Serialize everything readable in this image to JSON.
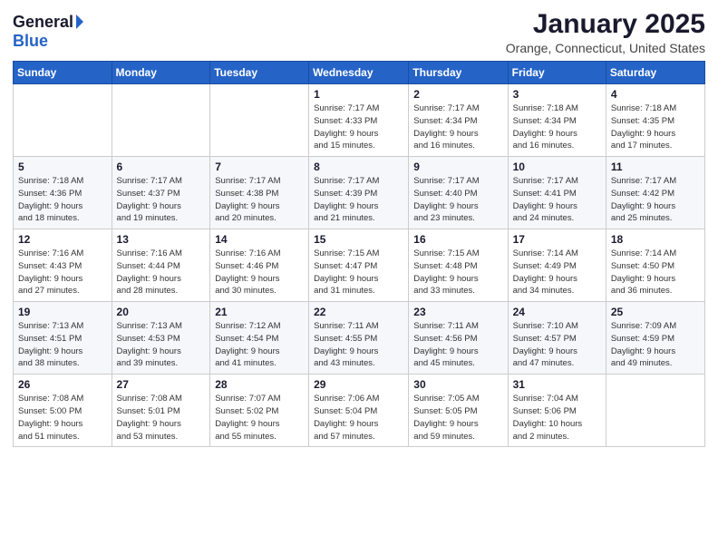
{
  "logo": {
    "general": "General",
    "blue": "Blue"
  },
  "title": "January 2025",
  "location": "Orange, Connecticut, United States",
  "weekdays": [
    "Sunday",
    "Monday",
    "Tuesday",
    "Wednesday",
    "Thursday",
    "Friday",
    "Saturday"
  ],
  "weeks": [
    [
      {
        "day": "",
        "info": ""
      },
      {
        "day": "",
        "info": ""
      },
      {
        "day": "",
        "info": ""
      },
      {
        "day": "1",
        "info": "Sunrise: 7:17 AM\nSunset: 4:33 PM\nDaylight: 9 hours\nand 15 minutes."
      },
      {
        "day": "2",
        "info": "Sunrise: 7:17 AM\nSunset: 4:34 PM\nDaylight: 9 hours\nand 16 minutes."
      },
      {
        "day": "3",
        "info": "Sunrise: 7:18 AM\nSunset: 4:34 PM\nDaylight: 9 hours\nand 16 minutes."
      },
      {
        "day": "4",
        "info": "Sunrise: 7:18 AM\nSunset: 4:35 PM\nDaylight: 9 hours\nand 17 minutes."
      }
    ],
    [
      {
        "day": "5",
        "info": "Sunrise: 7:18 AM\nSunset: 4:36 PM\nDaylight: 9 hours\nand 18 minutes."
      },
      {
        "day": "6",
        "info": "Sunrise: 7:17 AM\nSunset: 4:37 PM\nDaylight: 9 hours\nand 19 minutes."
      },
      {
        "day": "7",
        "info": "Sunrise: 7:17 AM\nSunset: 4:38 PM\nDaylight: 9 hours\nand 20 minutes."
      },
      {
        "day": "8",
        "info": "Sunrise: 7:17 AM\nSunset: 4:39 PM\nDaylight: 9 hours\nand 21 minutes."
      },
      {
        "day": "9",
        "info": "Sunrise: 7:17 AM\nSunset: 4:40 PM\nDaylight: 9 hours\nand 23 minutes."
      },
      {
        "day": "10",
        "info": "Sunrise: 7:17 AM\nSunset: 4:41 PM\nDaylight: 9 hours\nand 24 minutes."
      },
      {
        "day": "11",
        "info": "Sunrise: 7:17 AM\nSunset: 4:42 PM\nDaylight: 9 hours\nand 25 minutes."
      }
    ],
    [
      {
        "day": "12",
        "info": "Sunrise: 7:16 AM\nSunset: 4:43 PM\nDaylight: 9 hours\nand 27 minutes."
      },
      {
        "day": "13",
        "info": "Sunrise: 7:16 AM\nSunset: 4:44 PM\nDaylight: 9 hours\nand 28 minutes."
      },
      {
        "day": "14",
        "info": "Sunrise: 7:16 AM\nSunset: 4:46 PM\nDaylight: 9 hours\nand 30 minutes."
      },
      {
        "day": "15",
        "info": "Sunrise: 7:15 AM\nSunset: 4:47 PM\nDaylight: 9 hours\nand 31 minutes."
      },
      {
        "day": "16",
        "info": "Sunrise: 7:15 AM\nSunset: 4:48 PM\nDaylight: 9 hours\nand 33 minutes."
      },
      {
        "day": "17",
        "info": "Sunrise: 7:14 AM\nSunset: 4:49 PM\nDaylight: 9 hours\nand 34 minutes."
      },
      {
        "day": "18",
        "info": "Sunrise: 7:14 AM\nSunset: 4:50 PM\nDaylight: 9 hours\nand 36 minutes."
      }
    ],
    [
      {
        "day": "19",
        "info": "Sunrise: 7:13 AM\nSunset: 4:51 PM\nDaylight: 9 hours\nand 38 minutes."
      },
      {
        "day": "20",
        "info": "Sunrise: 7:13 AM\nSunset: 4:53 PM\nDaylight: 9 hours\nand 39 minutes."
      },
      {
        "day": "21",
        "info": "Sunrise: 7:12 AM\nSunset: 4:54 PM\nDaylight: 9 hours\nand 41 minutes."
      },
      {
        "day": "22",
        "info": "Sunrise: 7:11 AM\nSunset: 4:55 PM\nDaylight: 9 hours\nand 43 minutes."
      },
      {
        "day": "23",
        "info": "Sunrise: 7:11 AM\nSunset: 4:56 PM\nDaylight: 9 hours\nand 45 minutes."
      },
      {
        "day": "24",
        "info": "Sunrise: 7:10 AM\nSunset: 4:57 PM\nDaylight: 9 hours\nand 47 minutes."
      },
      {
        "day": "25",
        "info": "Sunrise: 7:09 AM\nSunset: 4:59 PM\nDaylight: 9 hours\nand 49 minutes."
      }
    ],
    [
      {
        "day": "26",
        "info": "Sunrise: 7:08 AM\nSunset: 5:00 PM\nDaylight: 9 hours\nand 51 minutes."
      },
      {
        "day": "27",
        "info": "Sunrise: 7:08 AM\nSunset: 5:01 PM\nDaylight: 9 hours\nand 53 minutes."
      },
      {
        "day": "28",
        "info": "Sunrise: 7:07 AM\nSunset: 5:02 PM\nDaylight: 9 hours\nand 55 minutes."
      },
      {
        "day": "29",
        "info": "Sunrise: 7:06 AM\nSunset: 5:04 PM\nDaylight: 9 hours\nand 57 minutes."
      },
      {
        "day": "30",
        "info": "Sunrise: 7:05 AM\nSunset: 5:05 PM\nDaylight: 9 hours\nand 59 minutes."
      },
      {
        "day": "31",
        "info": "Sunrise: 7:04 AM\nSunset: 5:06 PM\nDaylight: 10 hours\nand 2 minutes."
      },
      {
        "day": "",
        "info": ""
      }
    ]
  ]
}
